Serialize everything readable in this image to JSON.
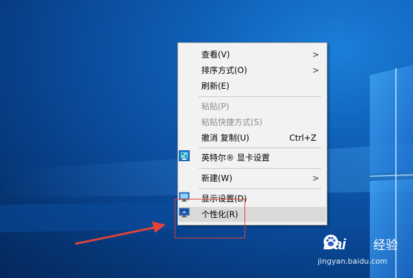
{
  "context_menu": {
    "items": [
      {
        "label": "查看(V)",
        "submenu": true
      },
      {
        "label": "排序方式(O)",
        "submenu": true
      },
      {
        "label": "刷新(E)"
      },
      {
        "label": "粘贴(P)",
        "disabled": true
      },
      {
        "label": "粘贴快捷方式(S)",
        "disabled": true
      },
      {
        "label": "撤消 复制(U)",
        "shortcut": "Ctrl+Z"
      },
      {
        "label": "英特尔® 显卡设置",
        "icon": "intel-graphics-icon"
      },
      {
        "label": "新建(W)",
        "submenu": true
      },
      {
        "label": "显示设置(D)",
        "icon": "display-icon"
      },
      {
        "label": "个性化(R)",
        "icon": "personalize-icon",
        "highlighted": true
      }
    ]
  },
  "watermark": {
    "brand_text": "Bai",
    "brand_cn": "经验",
    "url": "jingyan.baidu.com"
  },
  "colors": {
    "menu_bg": "#f2f2f2",
    "highlight": "#d9d9d9",
    "annotation_red": "#e0433a",
    "desktop_blue": "#0a4a9a"
  }
}
